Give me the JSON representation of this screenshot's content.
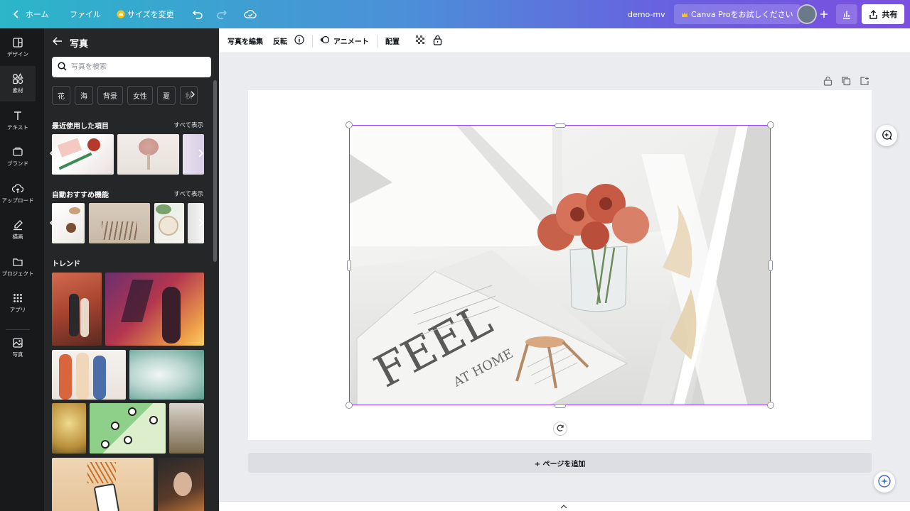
{
  "topbar": {
    "home_label": "ホーム",
    "file_label": "ファイル",
    "resize_label": "サイズを変更",
    "doc_title": "demo-mv",
    "pro_label": "Canva Proをお試しください",
    "share_label": "共有"
  },
  "sidebar": {
    "items": [
      {
        "label": "デザイン",
        "icon": "design-icon"
      },
      {
        "label": "素材",
        "icon": "elements-icon"
      },
      {
        "label": "テキスト",
        "icon": "text-icon"
      },
      {
        "label": "ブランド",
        "icon": "brand-icon"
      },
      {
        "label": "アップロード",
        "icon": "upload-icon"
      },
      {
        "label": "描画",
        "icon": "draw-icon"
      },
      {
        "label": "プロジェクト",
        "icon": "folder-icon"
      },
      {
        "label": "アプリ",
        "icon": "apps-icon"
      },
      {
        "label": "写真",
        "icon": "photo-icon"
      }
    ]
  },
  "panel": {
    "title": "写真",
    "search_placeholder": "写真を検索",
    "chips": [
      "花",
      "海",
      "背景",
      "女性",
      "夏",
      "秋"
    ],
    "recent_title": "最近使用した項目",
    "recent_link": "すべて表示",
    "auto_title": "自動おすすめ機能",
    "auto_link": "すべて表示",
    "trend_title": "トレンド"
  },
  "context_bar": {
    "edit_photo": "写真を編集",
    "flip": "反転",
    "animate": "アニメート",
    "position": "配置"
  },
  "photo_text": {
    "headline": "FEEL",
    "subline": "AT HOME"
  },
  "canvas": {
    "add_page_label": "+ ページを追加"
  },
  "colors": {
    "accent": "#8b3dff",
    "sidebar_bg": "#18191b",
    "panel_bg": "#252627",
    "gold": "#f5c518"
  }
}
